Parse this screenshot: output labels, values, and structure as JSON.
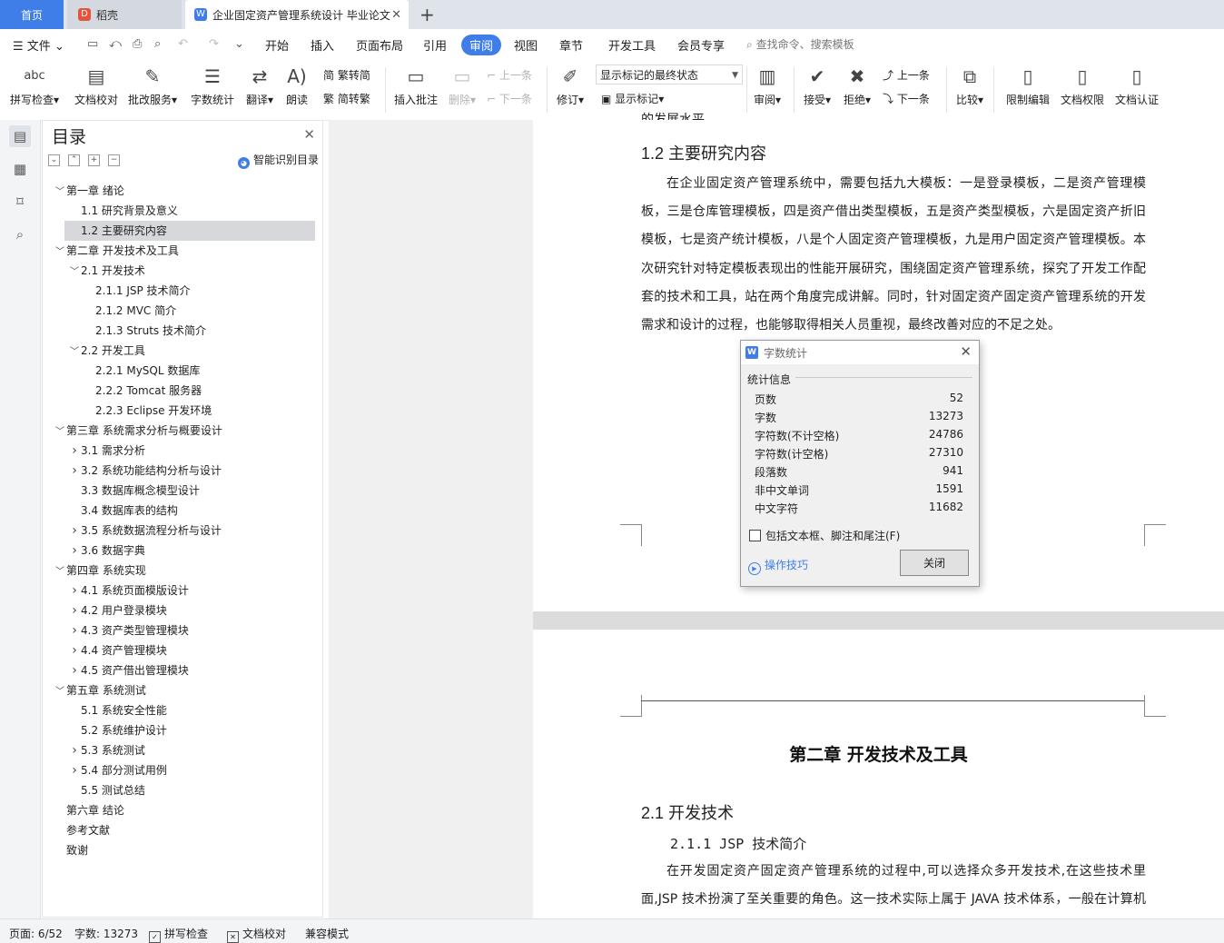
{
  "tabs": {
    "home": "首页",
    "daoke": "稻壳",
    "doc": "企业固定资产管理系统设计 毕业论文"
  },
  "menu": {
    "file": "文件",
    "items": [
      "开始",
      "插入",
      "页面布局",
      "引用",
      "审阅",
      "视图",
      "章节",
      "开发工具",
      "会员专享"
    ],
    "active": "审阅",
    "search_placeholder": "查找命令、搜索模板"
  },
  "ribbon": {
    "spell": "拼写检查",
    "doc_check": "文档校对",
    "batch": "批改服务",
    "word_count": "字数统计",
    "translate": "翻译",
    "read": "朗读",
    "trad_to_simp": "繁转简",
    "simp_to_trad": "简转繁",
    "insert_comment": "插入批注",
    "delete": "删除",
    "prev": "上一条",
    "next": "下一条",
    "revise": "修订",
    "markup_select": "显示标记的最终状态",
    "show_markup": "显示标记",
    "review": "审阅",
    "accept": "接受",
    "reject": "拒绝",
    "prev2": "上一条",
    "next2": "下一条",
    "compare": "比较",
    "restrict": "限制编辑",
    "permission": "文档权限",
    "certify": "文档认证"
  },
  "toc": {
    "title": "目录",
    "smart": "智能识别目录",
    "items": [
      {
        "text": "第一章  绪论",
        "level": 1,
        "caret": "v"
      },
      {
        "text": "1.1 研究背景及意义",
        "level": 2,
        "caret": ""
      },
      {
        "text": "1.2 主要研究内容",
        "level": 2,
        "caret": "",
        "highlight": true
      },
      {
        "text": "第二章    开发技术及工具",
        "level": 1,
        "caret": "v"
      },
      {
        "text": "2.1 开发技术",
        "level": 2,
        "caret": "v"
      },
      {
        "text": "2.1.1 JSP 技术简介",
        "level": 3,
        "caret": ""
      },
      {
        "text": "2.1.2 MVC 简介",
        "level": 3,
        "caret": ""
      },
      {
        "text": "2.1.3 Struts 技术简介",
        "level": 3,
        "caret": ""
      },
      {
        "text": "2.2 开发工具",
        "level": 2,
        "caret": "v"
      },
      {
        "text": "2.2.1 MySQL 数据库",
        "level": 3,
        "caret": ""
      },
      {
        "text": "2.2.2 Tomcat 服务器",
        "level": 3,
        "caret": ""
      },
      {
        "text": "2.2.3 Eclipse 开发环境",
        "level": 3,
        "caret": ""
      },
      {
        "text": "第三章    系统需求分析与概要设计",
        "level": 1,
        "caret": "v"
      },
      {
        "text": "3.1 需求分析",
        "level": 2,
        "caret": ">"
      },
      {
        "text": "3.2 系统功能结构分析与设计",
        "level": 2,
        "caret": ">"
      },
      {
        "text": "3.3 数据库概念模型设计",
        "level": 2,
        "caret": ""
      },
      {
        "text": "3.4 数据库表的结构",
        "level": 2,
        "caret": ""
      },
      {
        "text": "3.5 系统数据流程分析与设计",
        "level": 2,
        "caret": ">"
      },
      {
        "text": "3.6 数据字典",
        "level": 2,
        "caret": ">"
      },
      {
        "text": "第四章    系统实现",
        "level": 1,
        "caret": "v"
      },
      {
        "text": "4.1  系统页面模版设计",
        "level": 2,
        "caret": ">"
      },
      {
        "text": "4.2  用户登录模块",
        "level": 2,
        "caret": ">"
      },
      {
        "text": "4.3  资产类型管理模块",
        "level": 2,
        "caret": ">"
      },
      {
        "text": "4.4  资产管理模块",
        "level": 2,
        "caret": ">"
      },
      {
        "text": "4.5  资产借出管理模块",
        "level": 2,
        "caret": ">"
      },
      {
        "text": "第五章    系统测试",
        "level": 1,
        "caret": "v"
      },
      {
        "text": "5.1  系统安全性能",
        "level": 2,
        "caret": ""
      },
      {
        "text": "5.2  系统维护设计",
        "level": 2,
        "caret": ""
      },
      {
        "text": "5.3  系统测试",
        "level": 2,
        "caret": ">"
      },
      {
        "text": "5.4  部分测试用例",
        "level": 2,
        "caret": ">"
      },
      {
        "text": "5.5  测试总结",
        "level": 2,
        "caret": ""
      },
      {
        "text": "第六章    结论",
        "level": 1,
        "caret": ""
      },
      {
        "text": "参考文献",
        "level": 1,
        "caret": ""
      },
      {
        "text": "致谢",
        "level": 1,
        "caret": ""
      }
    ]
  },
  "document": {
    "cut_line": "的发展水平。",
    "h_1_2": "1.2 主要研究内容",
    "para_1_2": "在企业固定资产管理系统中，需要包括九大模板：一是登录模板，二是资产管理模板，三是仓库管理模板，四是资产借出类型模板，五是资产类型模板，六是固定资产折旧模板，七是资产统计模板，八是个人固定资产管理模板，九是用户固定资产管理模板。本次研究针对特定模板表现出的性能开展研究，围绕固定资产管理系统，探究了开发工作配套的技术和工具，站在两个角度完成讲解。同时，针对固定资产固定资产管理系统的开发需求和设计的过程，也能够取得相关人员重视，最终改善对应的不足之处。",
    "chapter2": "第二章    开发技术及工具",
    "h_2_1": "2.1 开发技术",
    "h_2_1_1": "2.1.1 JSP 技术简介",
    "para_2_1_1": "在开发固定资产固定资产管理系统的过程中,可以选择众多开发技术,在这些技术里面,JSP 技术扮演了至关重要的角色。这一技术实际上属于 JAVA 技术体系，一般在计算机服务"
  },
  "dialog": {
    "title": "字数统计",
    "section": "统计信息",
    "rows": [
      {
        "label": "页数",
        "value": "52"
      },
      {
        "label": "字数",
        "value": "13273"
      },
      {
        "label": "字符数(不计空格)",
        "value": "24786"
      },
      {
        "label": "字符数(计空格)",
        "value": "27310"
      },
      {
        "label": "段落数",
        "value": "941"
      },
      {
        "label": "非中文单词",
        "value": "1591"
      },
      {
        "label": "中文字符",
        "value": "11682"
      }
    ],
    "checkbox": "包括文本框、脚注和尾注(F)",
    "tips": "操作技巧",
    "close": "关闭"
  },
  "status": {
    "page": "页面: 6/52",
    "words": "字数: 13273",
    "spell": "拼写检查",
    "doc_check": "文档校对",
    "mode": "兼容模式"
  },
  "colors": {
    "accent": "#3f7ee8",
    "highlight": "#d6d8dc"
  }
}
